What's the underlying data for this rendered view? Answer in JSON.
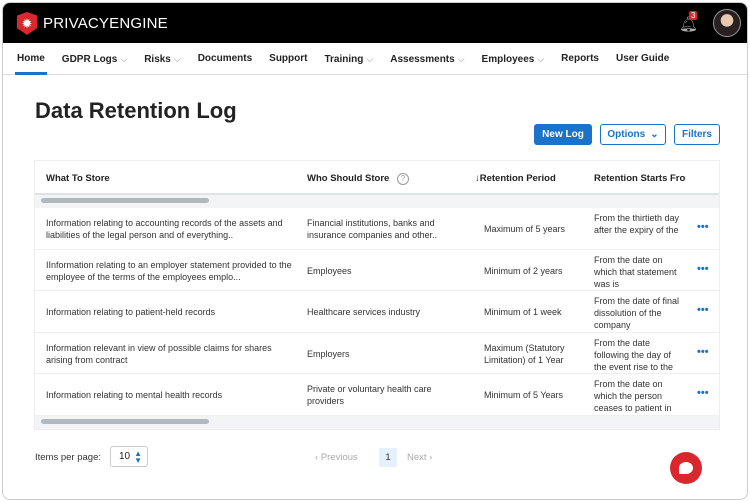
{
  "brand": {
    "name": "PRIVACYENGINE",
    "accent": "#d8282d",
    "primary": "#1a73c8"
  },
  "header": {
    "notification_count": "3"
  },
  "nav": [
    {
      "label": "Home",
      "dropdown": false,
      "active": true
    },
    {
      "label": "GDPR Logs",
      "dropdown": true
    },
    {
      "label": "Risks",
      "dropdown": true
    },
    {
      "label": "Documents",
      "dropdown": false
    },
    {
      "label": "Support",
      "dropdown": false
    },
    {
      "label": "Training",
      "dropdown": true
    },
    {
      "label": "Assessments",
      "dropdown": true
    },
    {
      "label": "Employees",
      "dropdown": true
    },
    {
      "label": "Reports",
      "dropdown": false
    },
    {
      "label": "User Guide",
      "dropdown": false
    }
  ],
  "page": {
    "title": "Data Retention Log",
    "new_log": "New Log",
    "options": "Options",
    "filters": "Filters"
  },
  "table": {
    "columns": [
      "What To Store",
      "Who Should Store",
      "Retention Period",
      "Retention Starts From"
    ],
    "rows": [
      {
        "what": "Information relating to accounting records of the assets and liabilities of the legal person and of everything..",
        "who": "Financial institutions, banks and insurance companies and other..",
        "period": "Maximum of 5 years",
        "starts": "From the thirtieth day after the expiry of the"
      },
      {
        "what": "IInformation relating to an employer statement provided to the employee of the terms of the employees emplo...",
        "who": "Employees",
        "period": "Minimum of 2 years",
        "starts": "From the date on which that statement was is"
      },
      {
        "what": "Information relating to patient-held records",
        "who": "Healthcare services industry",
        "period": "Minimum of 1 week",
        "starts": "From the date of final dissolution of the company"
      },
      {
        "what": "Information relevant in view of possible claims for shares arising from contract",
        "who": "Employers",
        "period": "Maximum (Statutory Limitation) of 1 Year",
        "starts": "From the date following the day of the event rise to the action"
      },
      {
        "what": "Information relating to mental health records",
        "who": "Private or voluntary health care providers",
        "period": "Minimum of 5 Years",
        "starts": "From the date on which the person ceases to patient in the hosp..."
      }
    ]
  },
  "pagination": {
    "items_per_page_label": "Items per page:",
    "items_per_page": "10",
    "previous": "Previous",
    "next": "Next",
    "current_page": "1"
  }
}
